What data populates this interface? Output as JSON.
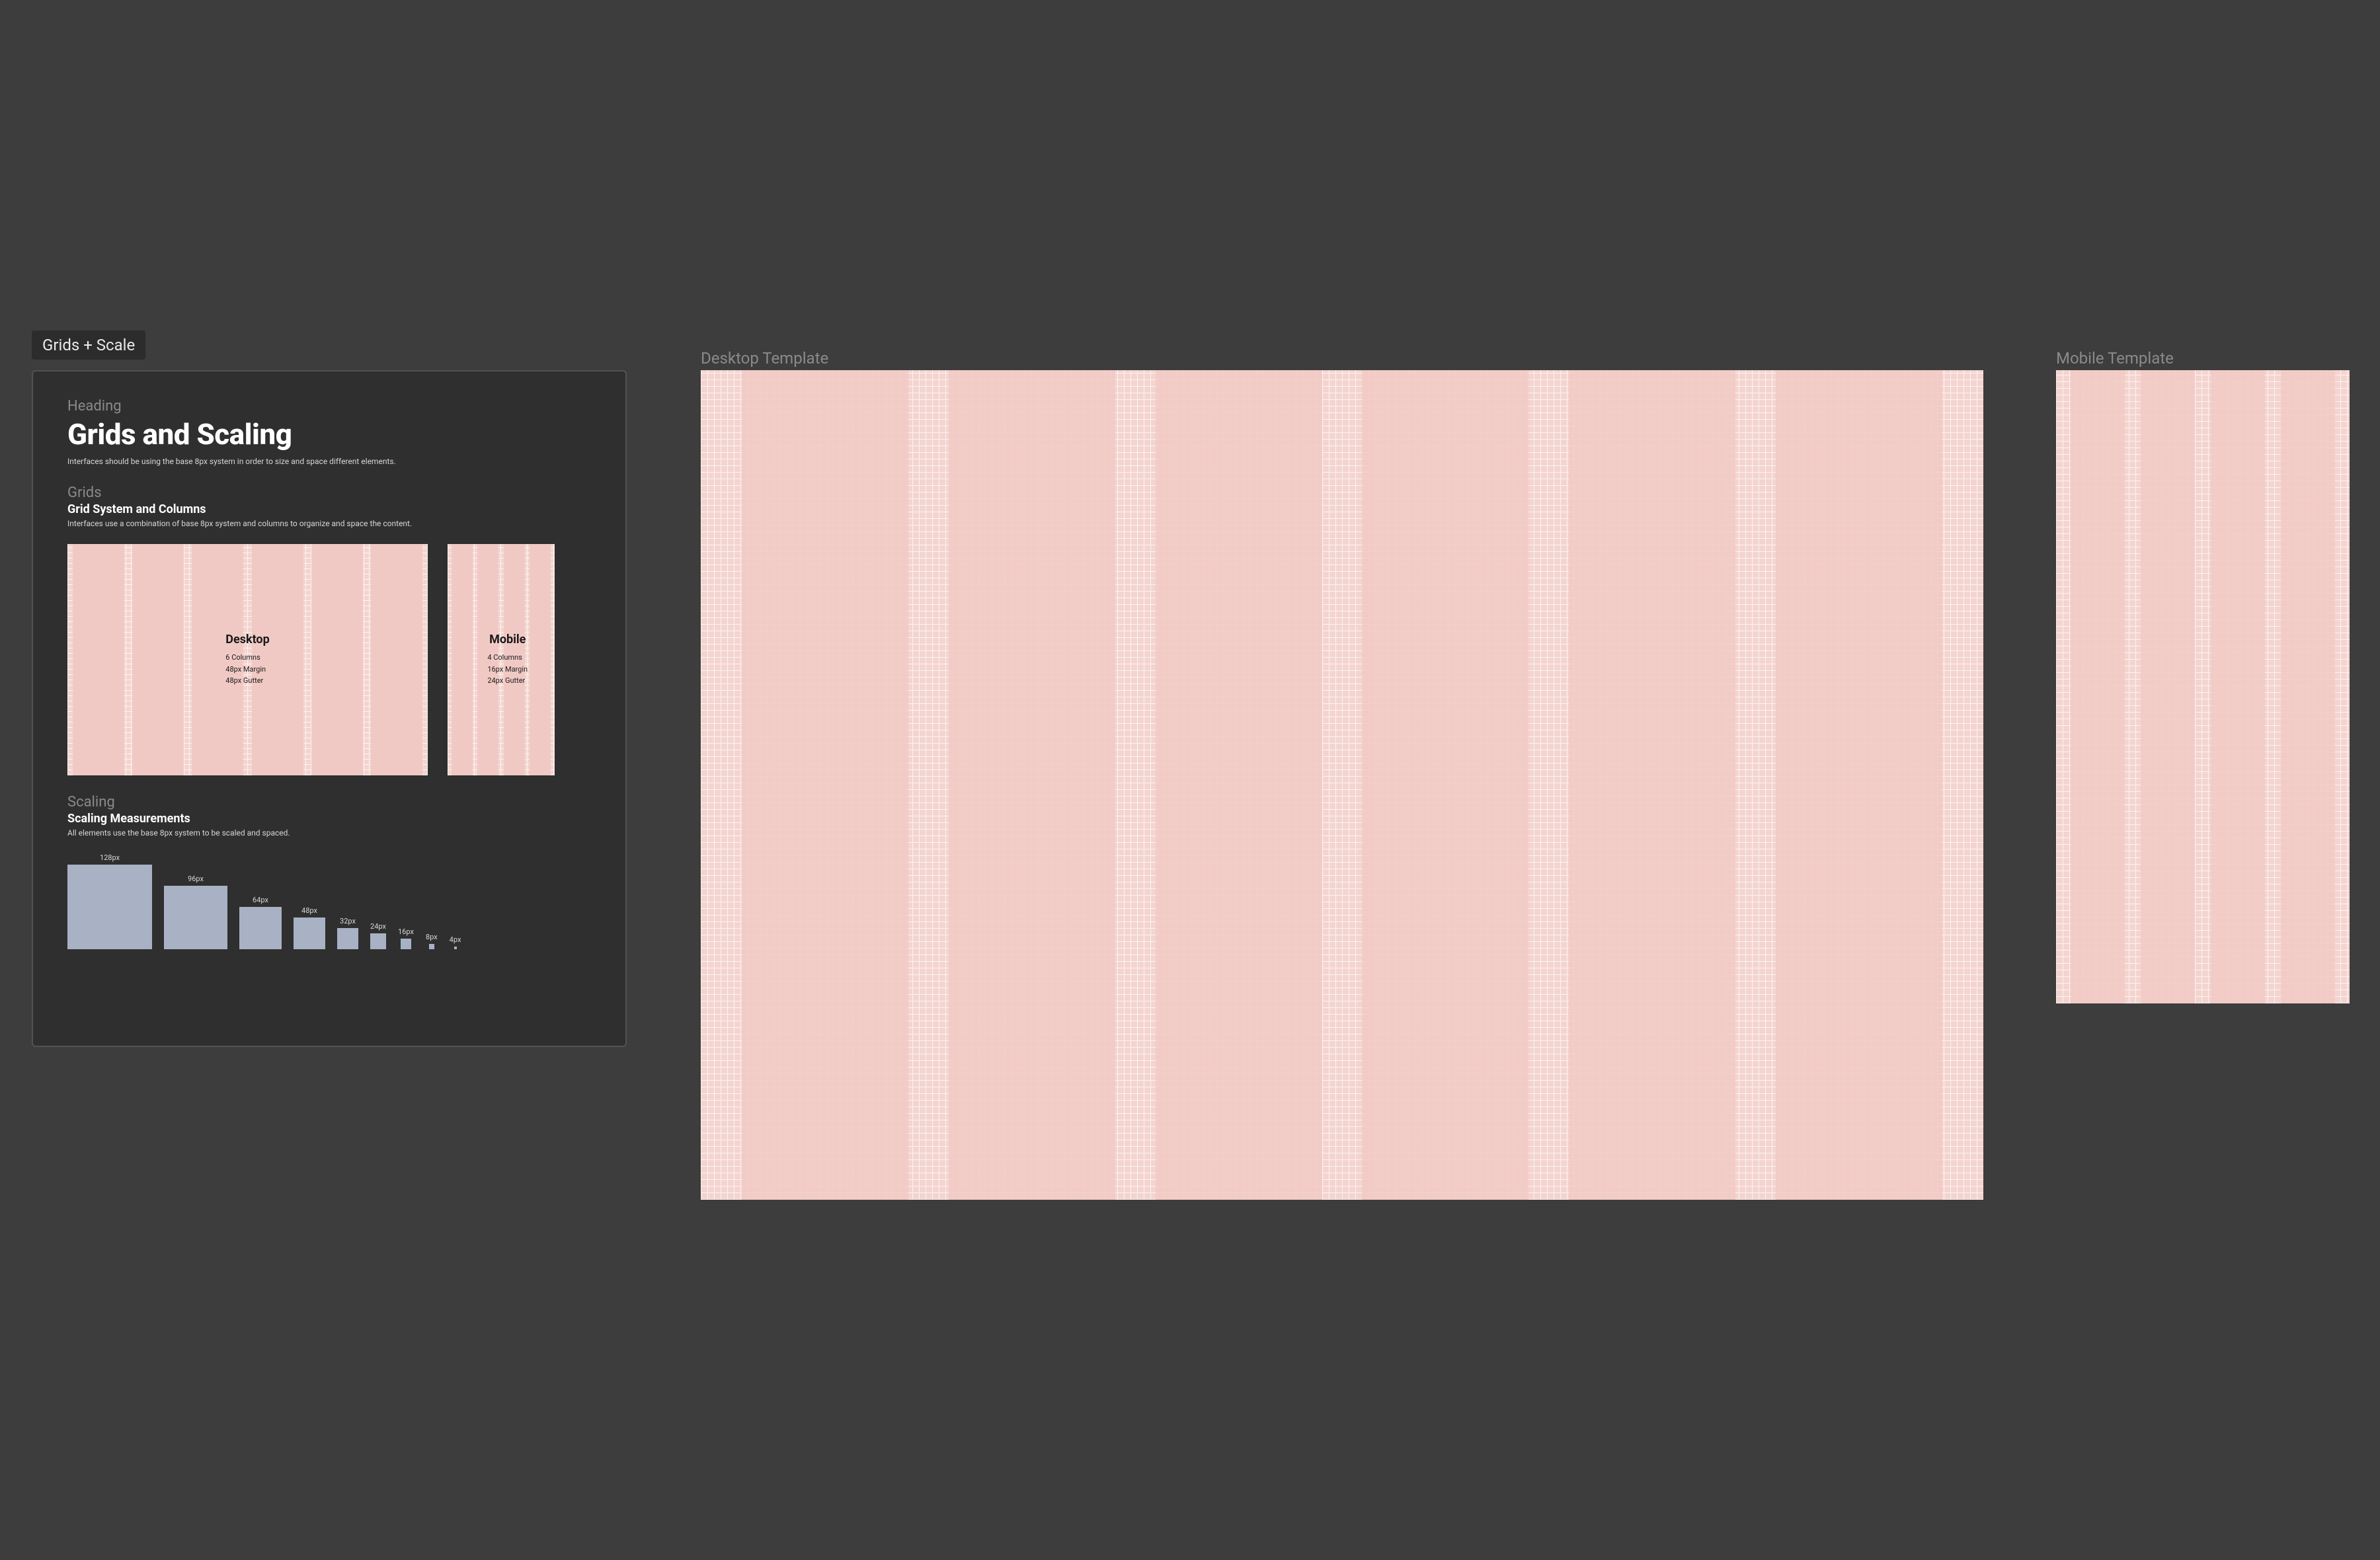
{
  "tag_label": "Grids + Scale",
  "card": {
    "heading_label": "Heading",
    "title": "Grids and Scaling",
    "intro": "Interfaces should be using the base 8px system in order to size and space different elements.",
    "grids": {
      "section_label": "Grids",
      "title": "Grid System and Columns",
      "text": "Interfaces use a combination of base 8px system and columns to organize and space the content.",
      "desktop": {
        "name": "Desktop",
        "columns": "6 Columns",
        "margin": "48px Margin",
        "gutter": "48px Gutter"
      },
      "mobile": {
        "name": "Mobile",
        "columns": "4 Columns",
        "margin": "16px Margin",
        "gutter": "24px Gutter"
      }
    },
    "scaling": {
      "section_label": "Scaling",
      "title": "Scaling Measurements",
      "text": "All elements use the base 8px system to be scaled and spaced.",
      "sizes": [
        {
          "label": "128px",
          "px": 128
        },
        {
          "label": "96px",
          "px": 96
        },
        {
          "label": "64px",
          "px": 64
        },
        {
          "label": "48px",
          "px": 48
        },
        {
          "label": "32px",
          "px": 32
        },
        {
          "label": "24px",
          "px": 24
        },
        {
          "label": "16px",
          "px": 16
        },
        {
          "label": "8px",
          "px": 8
        },
        {
          "label": "4px",
          "px": 4
        }
      ]
    }
  },
  "templates": {
    "desktop_label": "Desktop Template",
    "mobile_label": "Mobile Template"
  }
}
